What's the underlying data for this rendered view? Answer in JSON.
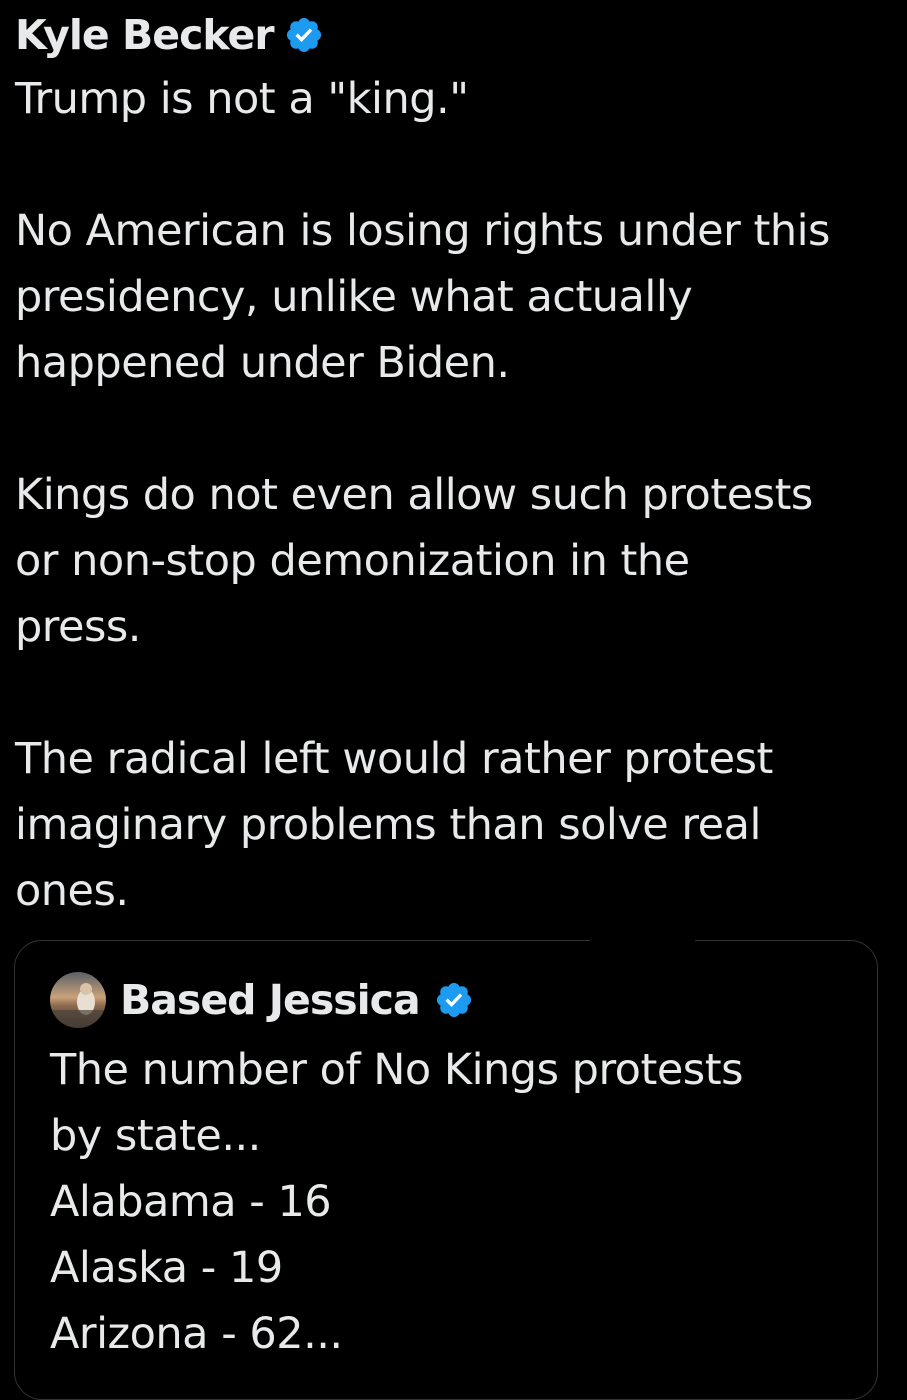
{
  "tweet": {
    "author": "Kyle Becker",
    "verified_icon": "verified-badge-icon",
    "paragraphs": [
      [
        "Trump is not a \"king.\""
      ],
      [
        "No American is losing rights under this",
        "presidency, unlike what actually",
        "happened under Biden."
      ],
      [
        "Kings do not even allow such protests",
        "or non-stop demonization in the",
        "press."
      ],
      [
        "The radical left would rather protest",
        "imaginary problems than solve real",
        "ones."
      ]
    ]
  },
  "quote": {
    "author": "Based Jessica",
    "verified_icon": "verified-badge-icon",
    "avatar_icon": "profile-avatar",
    "lines": [
      "The number of No Kings protests",
      "by state...",
      "Alabama - 16",
      "Alaska - 19",
      "Arizona - 62..."
    ]
  },
  "colors": {
    "background": "#000000",
    "text": "#e7e9ea",
    "verified": "#1d9bf0",
    "border": "#2f3336"
  }
}
